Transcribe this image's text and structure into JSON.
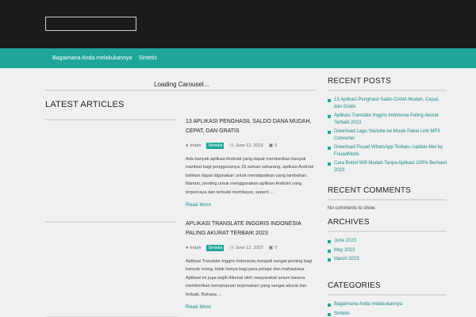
{
  "nav": {
    "items": [
      "Bagaimana Anda melakukannya",
      "Sintetis"
    ]
  },
  "carousel": {
    "loading_text": "Loading Carousel..."
  },
  "main": {
    "section_title": "LATEST ARTICLES",
    "articles": [
      {
        "title": "13 APLIKASI PENGHASIL SALDO DANA MUDAH, CEPAT, DAN GRATIS",
        "author": "Indah",
        "category": "Sintetis",
        "date": "June 12, 2023",
        "comments": "0",
        "excerpt": "Ada banyak aplikasi Android yang dapat memberikan banyak manfaat bagi penggunanya. Di zaman sekarang, aplikasi Android bahkan dapat digunakan untuk mendapatkan uang tambahan. Namun, penting untuk menggunakan aplikasi Android yang terpercaya dan terbukti membayar, seperti ...",
        "read_more": "Read More"
      },
      {
        "title": "APLIKASI TRANSLATE INGGRIS INDONESIA PALING AKURAT TERBAIK 2023",
        "author": "Indah",
        "category": "Sintetis",
        "date": "June 12, 2023",
        "comments": "0",
        "excerpt": "Aplikasi Translate Inggris Indonesia menjadi sangat penting bagi banyak orang, tidak hanya bagi para pelajar dan mahasiswa. Aplikasi ini juga wajib dikenal oleh masyarakat umum karena memberikan kemampuan terjemahan yang sangat akurat dan terbaik. Bahasa ...",
        "read_more": "Read More"
      }
    ]
  },
  "sidebar": {
    "recent_posts": {
      "title": "RECENT POSTS",
      "items": [
        "13 Aplikasi Penghasil Saldo DANA Mudah, Cepat, dan Gratis",
        "Aplikasi Translate Inggris Indonesia Paling Akurat Terbaik 2023",
        "Download Lagu Youtube ke Musik Pakai Link MP3 Converter",
        "Download Fouad WhatsApp Terbaru Update Mei by FouadMods",
        "Cara Bobol Wifi Mudah Tanpa Aplikasi 100% Berhasil 2023"
      ]
    },
    "recent_comments": {
      "title": "RECENT COMMENTS",
      "empty_text": "No comments to show."
    },
    "archives": {
      "title": "ARCHIVES",
      "items": [
        "June 2023",
        "May 2023",
        "March 2023"
      ]
    },
    "categories": {
      "title": "CATEGORIES",
      "items": [
        "Bagaimana Anda melakukannya",
        "Sintetis"
      ]
    }
  },
  "icons": {
    "author": "user-icon",
    "date": "clock-icon",
    "comments": "comment-icon"
  },
  "colors": {
    "topbar": "#1b1b1b",
    "accent": "#1fa69a",
    "link": "#1a8c86",
    "background": "#f0f0f0"
  }
}
